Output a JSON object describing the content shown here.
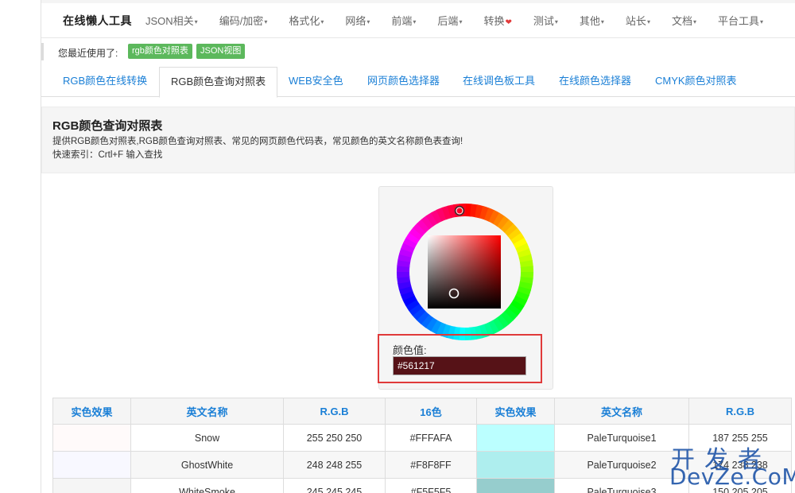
{
  "nav": {
    "brand": "在线懒人工具",
    "items": [
      {
        "label": "JSON相关",
        "suffix": "▾"
      },
      {
        "label": "编码/加密",
        "suffix": "▾"
      },
      {
        "label": "格式化",
        "suffix": "▾"
      },
      {
        "label": "网络",
        "suffix": "▾"
      },
      {
        "label": "前端",
        "suffix": "▾"
      },
      {
        "label": "后端",
        "suffix": "▾"
      },
      {
        "label": "转换",
        "suffix": "❤"
      },
      {
        "label": "测试",
        "suffix": "▾"
      },
      {
        "label": "其他",
        "suffix": "▾"
      },
      {
        "label": "站长",
        "suffix": "▾"
      },
      {
        "label": "文档",
        "suffix": "▾"
      },
      {
        "label": "平台工具",
        "suffix": "▾"
      }
    ]
  },
  "recent": {
    "label": "您最近使用了:",
    "tags": [
      "rgb颜色对照表",
      "JSON视图"
    ]
  },
  "tabs": [
    {
      "label": "RGB颜色在线转换",
      "active": false
    },
    {
      "label": "RGB颜色查询对照表",
      "active": true
    },
    {
      "label": "WEB安全色",
      "active": false
    },
    {
      "label": "网页颜色选择器",
      "active": false
    },
    {
      "label": "在线调色板工具",
      "active": false
    },
    {
      "label": "在线颜色选择器",
      "active": false
    },
    {
      "label": "CMYK颜色对照表",
      "active": false
    }
  ],
  "info": {
    "title": "RGB颜色查询对照表",
    "description": "提供RGB颜色对照表,RGB颜色查询对照表、常见的网页颜色代码表，常见颜色的英文名称颜色表查询!",
    "index": "快速索引：Crtl+F 输入查找"
  },
  "picker": {
    "value_label": "颜色值:",
    "value": "#561217",
    "swatch_color": "#561217"
  },
  "table": {
    "headers": [
      "实色效果",
      "英文名称",
      "R.G.B",
      "16色",
      "实色效果",
      "英文名称",
      "R.G.B"
    ],
    "rows": [
      {
        "c1": "#FFFAFA",
        "n1": "Snow",
        "r1": "255 250 250",
        "h1": "#FFFAFA",
        "c2": "#BBFFFF",
        "n2": "PaleTurquoise1",
        "r2": "187 255 255"
      },
      {
        "c1": "#F8F8FF",
        "n1": "GhostWhite",
        "r1": "248 248 255",
        "h1": "#F8F8FF",
        "c2": "#AEEEEE",
        "n2": "PaleTurquoise2",
        "r2": "174 238 238"
      },
      {
        "c1": "#F5F5F5",
        "n1": "WhiteSmoke",
        "r1": "245 245 245",
        "h1": "#F5F5F5",
        "c2": "#96CDCD",
        "n2": "PaleTurquoise3",
        "r2": "150 205 205"
      }
    ]
  },
  "watermark": {
    "cn": "开发者",
    "en": "DevZe.CoM"
  },
  "colors": {
    "accent": "#1a7fd6",
    "tag_green": "#5cb85c",
    "highlight_red": "#e03a3a"
  }
}
